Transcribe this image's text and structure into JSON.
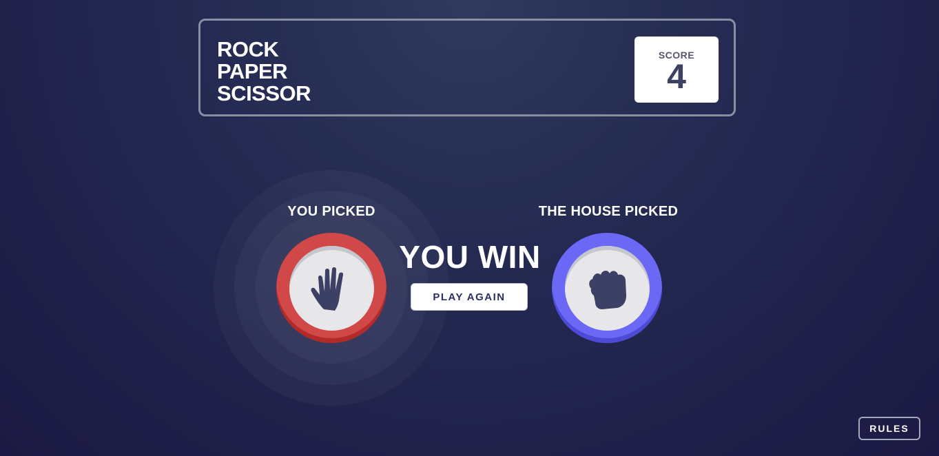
{
  "header": {
    "title_lines": [
      "ROCK",
      "PAPER",
      "SCISSOR"
    ],
    "score_label": "SCORE",
    "score_value": "4"
  },
  "game": {
    "you_picked_label": "YOU PICKED",
    "house_picked_label": "THE HOUSE PICKED",
    "player_choice": "paper",
    "house_choice": "rock",
    "result_text": "YOU WIN",
    "play_again_label": "PLAY AGAIN"
  },
  "footer": {
    "rules_label": "RULES"
  },
  "colors": {
    "paper_ring": "#d04848",
    "rock_ring": "#6a68f5",
    "icon_fill": "#3b4064"
  }
}
